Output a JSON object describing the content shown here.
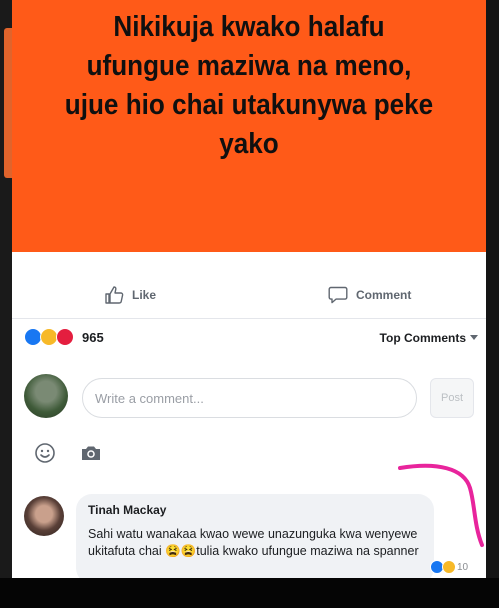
{
  "post": {
    "text": "Nikikuja kwako halafu ufungue maziwa na meno, ujue hio chai utakunywa peke yako",
    "image_background": "#ff5a18"
  },
  "actions": {
    "like_label": "Like",
    "comment_label": "Comment"
  },
  "reactions": {
    "types": [
      "like",
      "haha",
      "love"
    ],
    "count": "965"
  },
  "sort": {
    "label": "Top Comments"
  },
  "composer": {
    "placeholder": "Write a comment...",
    "post_label": "Post"
  },
  "comment": {
    "author": "Tinah Mackay",
    "body": "Sahi watu wanakaa kwao wewe unazunguka kwa wenyewe ukitafuta chai 😫😫tulia kwako ufungue maziwa na spanner",
    "reaction_count": "10"
  },
  "colors": {
    "accent": "#1877f2",
    "annotation": "#e8249c"
  }
}
